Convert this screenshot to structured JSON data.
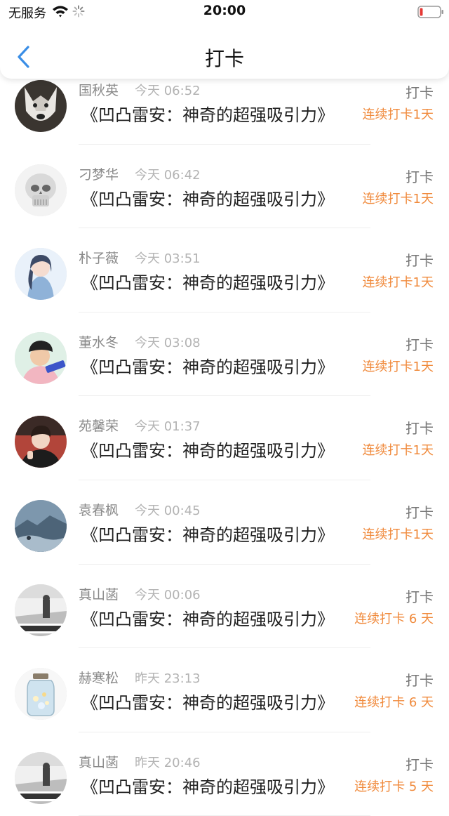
{
  "status_bar": {
    "carrier": "无服务",
    "time": "20:00",
    "icons": [
      "wifi-icon",
      "activity-icon",
      "battery-icon"
    ],
    "battery_color": "#e53935"
  },
  "nav": {
    "title": "打卡",
    "back_icon": "chevron-left-icon",
    "accent_color": "#3a8ee6"
  },
  "colors": {
    "streak": "#f08a3c",
    "name": "#8a8a8a",
    "time": "#b3b3b3"
  },
  "items": [
    {
      "name": "国秋英",
      "time": "今天 06:52",
      "book": "《凹凸雷安：神奇的超强吸引力》",
      "action": "打卡",
      "streak": "连续打卡1天",
      "avatar": "husky-avatar"
    },
    {
      "name": "刁梦华",
      "time": "今天 06:42",
      "book": "《凹凸雷安：神奇的超强吸引力》",
      "action": "打卡",
      "streak": "连续打卡1天",
      "avatar": "skull-avatar"
    },
    {
      "name": "朴子薇",
      "time": "今天 03:51",
      "book": "《凹凸雷安：神奇的超强吸引力》",
      "action": "打卡",
      "streak": "连续打卡1天",
      "avatar": "anime-girl-avatar"
    },
    {
      "name": "董水冬",
      "time": "今天 03:08",
      "book": "《凹凸雷安：神奇的超强吸引力》",
      "action": "打卡",
      "streak": "连续打卡1天",
      "avatar": "boy-cap-avatar"
    },
    {
      "name": "苑馨荣",
      "time": "今天 01:37",
      "book": "《凹凸雷安：神奇的超强吸引力》",
      "action": "打卡",
      "streak": "连续打卡1天",
      "avatar": "boy-portrait-avatar"
    },
    {
      "name": "袁春枫",
      "time": "今天 00:45",
      "book": "《凹凸雷安：神奇的超强吸引力》",
      "action": "打卡",
      "streak": "连续打卡1天",
      "avatar": "landscape-avatar"
    },
    {
      "name": "真山菡",
      "time": "今天 00:06",
      "book": "《凹凸雷安：神奇的超强吸引力》",
      "action": "打卡",
      "streak": "连续打卡 6 天",
      "avatar": "street-avatar"
    },
    {
      "name": "赫寒松",
      "time": "昨天 23:13",
      "book": "《凹凸雷安：神奇的超强吸引力》",
      "action": "打卡",
      "streak": "连续打卡 6 天",
      "avatar": "jar-avatar"
    },
    {
      "name": "真山菡",
      "time": "昨天 20:46",
      "book": "《凹凸雷安：神奇的超强吸引力》",
      "action": "打卡",
      "streak": "连续打卡 5 天",
      "avatar": "street-avatar"
    }
  ]
}
